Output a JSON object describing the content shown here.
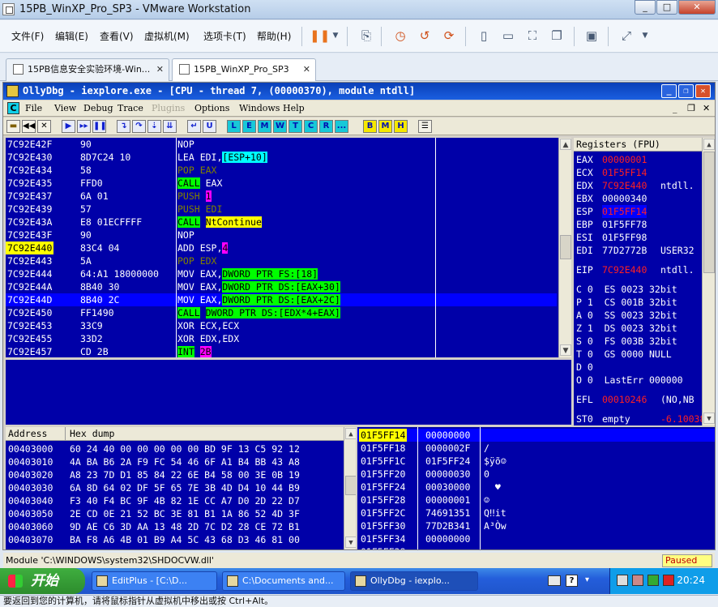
{
  "vm": {
    "title": "15PB_WinXP_Pro_SP3 - VMware Workstation",
    "menus": [
      "文件(F)",
      "编辑(E)",
      "查看(V)",
      "虚拟机(M)",
      "选项卡(T)",
      "帮助(H)"
    ],
    "tabs": [
      {
        "label": "15PB信息安全实验环境-Win...",
        "active": false
      },
      {
        "label": "15PB_WinXP_Pro_SP3",
        "active": true
      }
    ],
    "hint": "要返回到您的计算机，请将鼠标指针从虚拟机中移出或按 Ctrl+Alt。"
  },
  "olly": {
    "title": "OllyDbg - iexplore.exe - [CPU - thread 7, (00000370), module ntdll]",
    "menus": [
      {
        "label": "File",
        "disabled": false
      },
      {
        "label": "View",
        "disabled": false
      },
      {
        "label": "Debug",
        "disabled": false
      },
      {
        "label": "Trace",
        "disabled": false
      },
      {
        "label": "Plugins",
        "disabled": true
      },
      {
        "label": "Options",
        "disabled": false
      },
      {
        "label": "Windows",
        "disabled": false
      },
      {
        "label": "Help",
        "disabled": false
      }
    ],
    "toolbar_letters": [
      "L",
      "E",
      "M",
      "W",
      "T",
      "C",
      "R",
      "...",
      "B",
      "M",
      "H"
    ],
    "disasm": [
      {
        "addr": "7C92E42F",
        "hex": "90",
        "cmd": [
          {
            "t": "NOP"
          }
        ]
      },
      {
        "addr": "7C92E430",
        "hex": "8D7C24 10",
        "cmd": [
          {
            "t": "LEA EDI,"
          },
          {
            "t": "[ESP+10]",
            "c": "op-cyan"
          }
        ]
      },
      {
        "addr": "7C92E434",
        "hex": "58",
        "cmd": [
          {
            "t": "POP EAX",
            "c": "kw-pop"
          }
        ]
      },
      {
        "addr": "7C92E435",
        "hex": "FFD0",
        "cmd": [
          {
            "t": "CALL",
            "c": "kw-call"
          },
          {
            "t": " EAX"
          }
        ]
      },
      {
        "addr": "7C92E437",
        "hex": "6A 01",
        "cmd": [
          {
            "t": "PUSH ",
            "c": "kw-push"
          },
          {
            "t": "1",
            "c": "op-mag"
          }
        ]
      },
      {
        "addr": "7C92E439",
        "hex": "57",
        "cmd": [
          {
            "t": "PUSH EDI",
            "c": "kw-push"
          }
        ]
      },
      {
        "addr": "7C92E43A",
        "hex": "E8 01ECFFFF",
        "cmd": [
          {
            "t": "CALL",
            "c": "kw-call"
          },
          {
            "t": " "
          },
          {
            "t": "NtContinue",
            "c": "op-yel"
          }
        ]
      },
      {
        "addr": "7C92E43F",
        "hex": "90",
        "cmd": [
          {
            "t": "NOP"
          }
        ]
      },
      {
        "addr": "7C92E440",
        "hex": "83C4 04",
        "hl": true,
        "cmd": [
          {
            "t": "ADD ESP,"
          },
          {
            "t": "4",
            "c": "op-mag"
          }
        ]
      },
      {
        "addr": "7C92E443",
        "hex": "5A",
        "cmd": [
          {
            "t": "POP EDX",
            "c": "kw-pop"
          }
        ]
      },
      {
        "addr": "7C92E444",
        "hex": "64:A1 18000000",
        "cmd": [
          {
            "t": "MOV EAX,"
          },
          {
            "t": "DWORD PTR FS:[18]",
            "c": "op-grn"
          }
        ]
      },
      {
        "addr": "7C92E44A",
        "hex": "8B40 30",
        "cmd": [
          {
            "t": "MOV EAX,"
          },
          {
            "t": "DWORD PTR DS:[EAX+30]",
            "c": "op-grn"
          }
        ]
      },
      {
        "addr": "7C92E44D",
        "hex": "8B40 2C",
        "sel": true,
        "cmd": [
          {
            "t": "MOV EAX,"
          },
          {
            "t": "DWORD PTR DS:[EAX+2C]",
            "c": "op-grn"
          }
        ]
      },
      {
        "addr": "7C92E450",
        "hex": "FF1490",
        "cmd": [
          {
            "t": "CALL",
            "c": "kw-call"
          },
          {
            "t": " "
          },
          {
            "t": "DWORD PTR DS:[EDX*4+EAX]",
            "c": "op-grn"
          }
        ]
      },
      {
        "addr": "7C92E453",
        "hex": "33C9",
        "cmd": [
          {
            "t": "XOR ECX,ECX"
          }
        ]
      },
      {
        "addr": "7C92E455",
        "hex": "33D2",
        "cmd": [
          {
            "t": "XOR EDX,EDX"
          }
        ]
      },
      {
        "addr": "7C92E457",
        "hex": "CD 2B",
        "cmd": [
          {
            "t": "INT",
            "c": "kw-int"
          },
          {
            "t": " "
          },
          {
            "t": "2B",
            "c": "op-mag"
          }
        ]
      }
    ],
    "registers_title": "Registers (FPU)",
    "registers": [
      {
        "n": "EAX",
        "v": "00000001",
        "cls": "red"
      },
      {
        "n": "ECX",
        "v": "01F5FF14",
        "cls": "red"
      },
      {
        "n": "EDX",
        "v": "7C92E440",
        "cls": "red",
        "x": "ntdll."
      },
      {
        "n": "EBX",
        "v": "00000340"
      },
      {
        "n": "ESP",
        "v": "01F5FF14",
        "cls": "sel"
      },
      {
        "n": "EBP",
        "v": "01F5FF78"
      },
      {
        "n": "ESI",
        "v": "01F5FF98"
      },
      {
        "n": "EDI",
        "v": "77D2772B",
        "x": "USER32"
      },
      {
        "gap": true
      },
      {
        "n": "EIP",
        "v": "7C92E440",
        "cls": "red",
        "x": "ntdll."
      },
      {
        "gap": true
      },
      {
        "raw": "C 0  ES 0023 32bit"
      },
      {
        "raw": "P 1  CS 001B 32bit"
      },
      {
        "raw": "A 0  SS 0023 32bit"
      },
      {
        "raw": "Z 1  DS 0023 32bit"
      },
      {
        "raw": "S 0  FS 003B 32bit"
      },
      {
        "raw": "T 0  GS 0000 NULL"
      },
      {
        "raw": "D 0"
      },
      {
        "raw": "O 0  LastErr 000000"
      },
      {
        "gap": true
      },
      {
        "n": "EFL",
        "v": "00010246",
        "cls": "red",
        "x": "(NO,NB"
      },
      {
        "gap": true
      },
      {
        "n": "ST0",
        "v": "empty",
        "x": "-6.100389"
      }
    ],
    "dump_header": {
      "addr": "Address",
      "hex": "Hex dump"
    },
    "dump": [
      {
        "a": "00403000",
        "h": "60 24 40 00 00 00 00 00 BD 9F 13 C5 92 12"
      },
      {
        "a": "00403010",
        "h": "4A BA B6 2A F9 FC 54 46 6F A1 B4 BB 43 A8"
      },
      {
        "a": "00403020",
        "h": "A8 23 7D D1 85 84 22 6E B4 58 00 3E 0B 19"
      },
      {
        "a": "00403030",
        "h": "6A 8D 64 02 DF 5F 65 7E 3B 4D D4 10 44 B9"
      },
      {
        "a": "00403040",
        "h": "F3 40 F4 BC 9F 4B 82 1E CC A7 D0 2D 22 D7"
      },
      {
        "a": "00403050",
        "h": "2E CD 0E 21 52 BC 3E 81 B1 1A 86 52 4D 3F"
      },
      {
        "a": "00403060",
        "h": "9D AE C6 3D AA 13 48 2D 7C D2 28 CE 72 B1"
      },
      {
        "a": "00403070",
        "h": "BA F8 A6 4B 01 B9 A4 5C 43 68 D3 46 81 00"
      }
    ],
    "stack": [
      {
        "a": "01F5FF14",
        "v": "00000000",
        "c": "",
        "sel": true
      },
      {
        "a": "01F5FF18",
        "v": "0000002F",
        "c": "/"
      },
      {
        "a": "01F5FF1C",
        "v": "01F5FF24",
        "c": "$ÿõ☺"
      },
      {
        "a": "01F5FF20",
        "v": "00000030",
        "c": "0"
      },
      {
        "a": "01F5FF24",
        "v": "00030000",
        "c": "  ♥"
      },
      {
        "a": "01F5FF28",
        "v": "00000001",
        "c": "☺"
      },
      {
        "a": "01F5FF2C",
        "v": "74691351",
        "c": "Q‼it"
      },
      {
        "a": "01F5FF30",
        "v": "77D2B341",
        "c": "A³Òw"
      },
      {
        "a": "01F5FF34",
        "v": "00000000",
        "c": ""
      },
      {
        "a": "01F5FF38",
        "v": "",
        "c": ""
      }
    ],
    "status_module": "Module 'C:\\WINDOWS\\system32\\SHDOCVW.dll'",
    "status_state": "Paused"
  },
  "taskbar": {
    "start": "开始",
    "tasks": [
      {
        "label": "EditPlus - [C:\\D...",
        "active": false
      },
      {
        "label": "C:\\Documents and...",
        "active": false
      },
      {
        "label": "OllyDbg - iexplo...",
        "active": true
      }
    ],
    "clock": "20:24"
  }
}
